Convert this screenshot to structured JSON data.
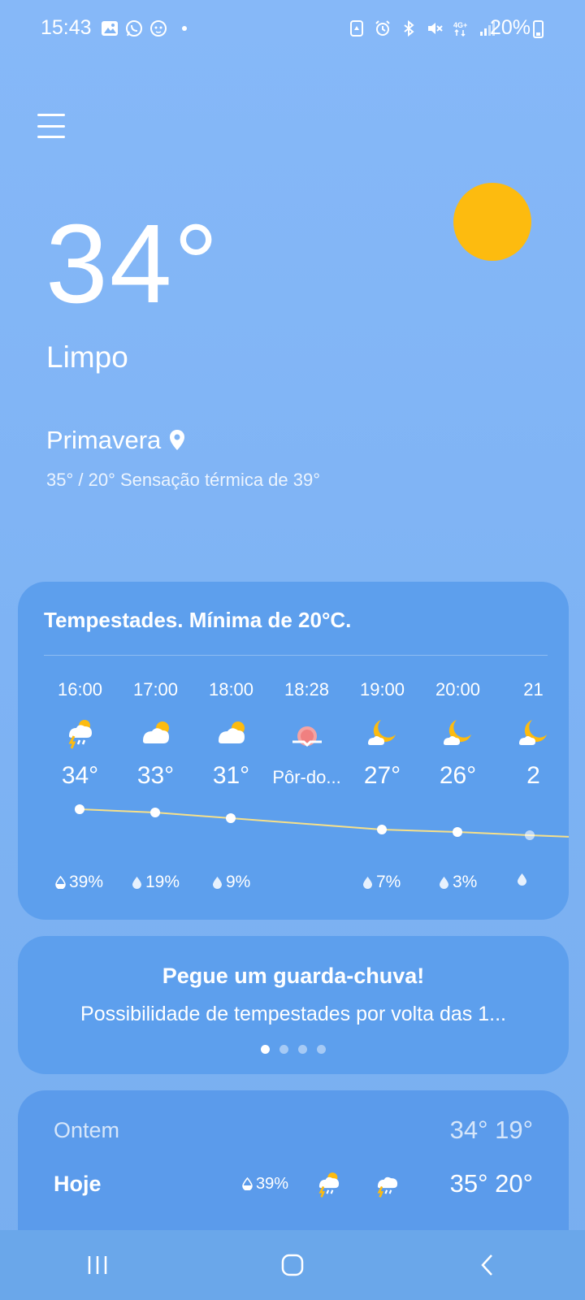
{
  "status_bar": {
    "time": "15:43",
    "battery": "20%",
    "left_icons": [
      "gallery-icon",
      "whatsapp-icon",
      "app-icon"
    ],
    "right_icons": [
      "recycle-icon",
      "alarm-icon",
      "bluetooth-icon",
      "mute-icon",
      "4g-icon",
      "signal-icon"
    ]
  },
  "current": {
    "temperature": "34°",
    "condition": "Limpo",
    "location": "Primavera",
    "details": "35° / 20° Sensação térmica de 39°"
  },
  "hourly": {
    "summary": "Tempestades. Mínima de 20°C.",
    "hours": [
      {
        "time": "16:00",
        "icon": "thunderstorm-icon",
        "temp": "34°",
        "precip": "39%"
      },
      {
        "time": "17:00",
        "icon": "partly-cloudy-icon",
        "temp": "33°",
        "precip": "19%"
      },
      {
        "time": "18:00",
        "icon": "partly-cloudy-icon",
        "temp": "31°",
        "precip": "9%"
      },
      {
        "time": "18:28",
        "icon": "sunset-icon",
        "temp": "Pôr-do...",
        "precip": ""
      },
      {
        "time": "19:00",
        "icon": "moon-cloud-icon",
        "temp": "27°",
        "precip": "7%"
      },
      {
        "time": "20:00",
        "icon": "moon-cloud-icon",
        "temp": "26°",
        "precip": "3%"
      },
      {
        "time": "21",
        "icon": "moon-cloud-icon",
        "temp": "2",
        "precip": ""
      }
    ]
  },
  "alert": {
    "title": "Pegue um guarda-chuva!",
    "description": "Possibilidade de tempestades por volta das 1..."
  },
  "daily": [
    {
      "day": "Ontem",
      "temps": "34° 19°"
    },
    {
      "day": "Hoje",
      "precip": "39%",
      "temps": "35° 20°"
    }
  ],
  "colors": {
    "sun": "#fdbb0f",
    "trend_line": "#f6e08a",
    "background": "#7eb3f4"
  }
}
